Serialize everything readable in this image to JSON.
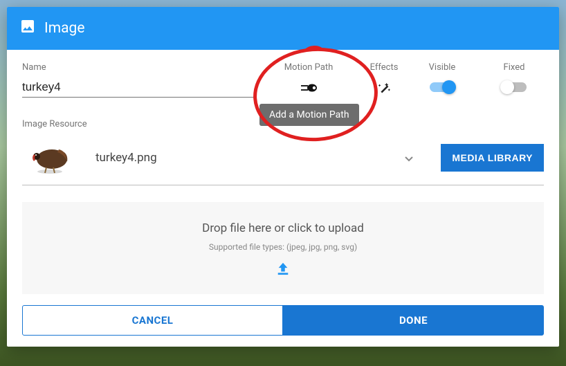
{
  "header": {
    "title": "Image"
  },
  "fields": {
    "name_label": "Name",
    "name_value": "turkey4",
    "motion_path_label": "Motion Path",
    "effects_label": "Effects",
    "visible_label": "Visible",
    "fixed_label": "Fixed",
    "visible_on": true,
    "fixed_on": false
  },
  "tooltip": {
    "motion_path": "Add a Motion Path"
  },
  "resource": {
    "label": "Image Resource",
    "filename": "turkey4.png",
    "media_library_button": "MEDIA LIBRARY"
  },
  "dropzone": {
    "title": "Drop file here or click to upload",
    "subtitle": "Supported file types: (jpeg, jpg, png, svg)"
  },
  "footer": {
    "cancel": "CANCEL",
    "done": "DONE"
  },
  "colors": {
    "primary": "#2196F3",
    "primary_dark": "#1976D2"
  }
}
